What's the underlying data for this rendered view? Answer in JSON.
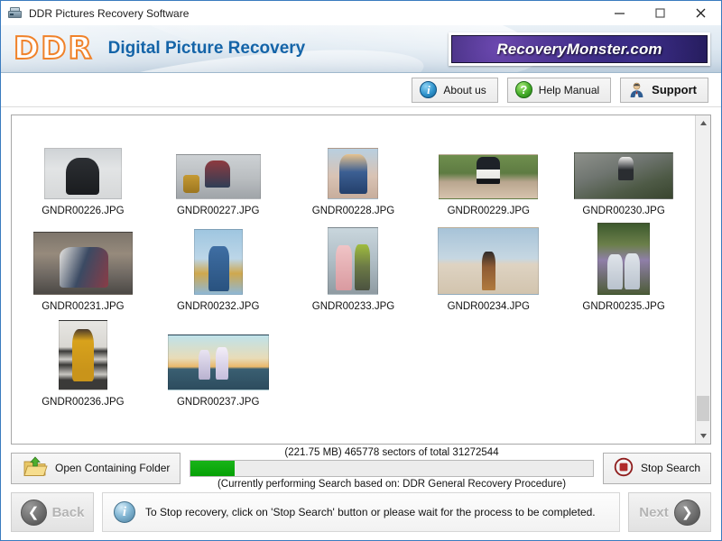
{
  "window": {
    "title": "DDR Pictures Recovery Software",
    "icon": "scanner-icon",
    "minimize_label": "─",
    "maximize_label": "□",
    "close_label": "✕"
  },
  "header": {
    "logo_text": "DDR",
    "product_title": "Digital Picture Recovery",
    "site_badge": "RecoveryMonster.com",
    "logo_color": "#f0822a",
    "title_color": "#1464a8",
    "badge_bg": "#2b2070"
  },
  "toolbar": {
    "buttons": [
      {
        "label": "About us",
        "icon": "info-icon",
        "glyph": "i"
      },
      {
        "label": "Help Manual",
        "icon": "question-mark-icon",
        "glyph": "?"
      },
      {
        "label": "Support",
        "icon": "support-person-icon",
        "glyph": ""
      }
    ]
  },
  "filelist": {
    "files": [
      {
        "name": "GNDR00226.JPG",
        "thumb": "t226",
        "w": 86,
        "h": 57
      },
      {
        "name": "GNDR00227.JPG",
        "thumb": "t227",
        "w": 94,
        "h": 50
      },
      {
        "name": "GNDR00228.JPG",
        "thumb": "t228",
        "w": 56,
        "h": 57
      },
      {
        "name": "GNDR00229.JPG",
        "thumb": "t229",
        "w": 110,
        "h": 50
      },
      {
        "name": "GNDR00230.JPG",
        "thumb": "t230",
        "w": 110,
        "h": 52
      },
      {
        "name": "GNDR00231.JPG",
        "thumb": "t231",
        "w": 110,
        "h": 70
      },
      {
        "name": "GNDR00232.JPG",
        "thumb": "t232",
        "w": 54,
        "h": 73
      },
      {
        "name": "GNDR00233.JPG",
        "thumb": "t233",
        "w": 56,
        "h": 75
      },
      {
        "name": "GNDR00234.JPG",
        "thumb": "t234",
        "w": 112,
        "h": 75
      },
      {
        "name": "GNDR00235.JPG",
        "thumb": "t235",
        "w": 58,
        "h": 80
      },
      {
        "name": "GNDR00236.JPG",
        "thumb": "t236",
        "w": 54,
        "h": 78
      },
      {
        "name": "GNDR00237.JPG",
        "thumb": "t237",
        "w": 112,
        "h": 62
      }
    ]
  },
  "scrollbar": {
    "up_glyph": "▲",
    "down_glyph": "▼"
  },
  "status": {
    "open_folder_label": "Open Containing Folder",
    "open_folder_icon": "folder-up-arrow-icon",
    "progress_caption": "(221.75 MB) 465778  sectors  of  total 31272544",
    "progress_sub": "(Currently performing Search based on:  DDR General Recovery Procedure)",
    "progress_percent": 11,
    "progress_color": "#06a106",
    "stop_label": "Stop Search",
    "stop_icon": "stop-circle-icon"
  },
  "navbar": {
    "back_label": "Back",
    "back_icon": "chevron-left-icon",
    "next_label": "Next",
    "next_icon": "chevron-right-icon",
    "message": "To Stop recovery, click on 'Stop Search' button or please wait for the process to be completed.",
    "message_icon": "info-icon"
  }
}
